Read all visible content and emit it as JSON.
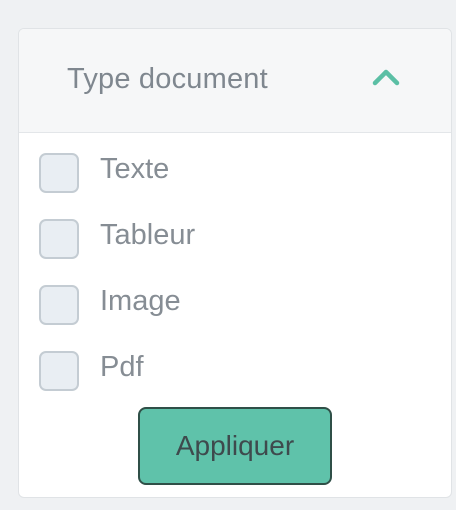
{
  "filter": {
    "title": "Type document",
    "expanded": true,
    "toggle_icon": "chevron-up-icon",
    "options": [
      {
        "label": "Texte",
        "checked": false
      },
      {
        "label": "Tableur",
        "checked": false
      },
      {
        "label": "Image",
        "checked": false
      },
      {
        "label": "Pdf",
        "checked": false
      }
    ],
    "apply_label": "Appliquer"
  },
  "colors": {
    "accent": "#5fc2aa",
    "chevron": "#5bbfa5",
    "text": "#868d94",
    "checkbox_fill": "#e9eef3"
  }
}
